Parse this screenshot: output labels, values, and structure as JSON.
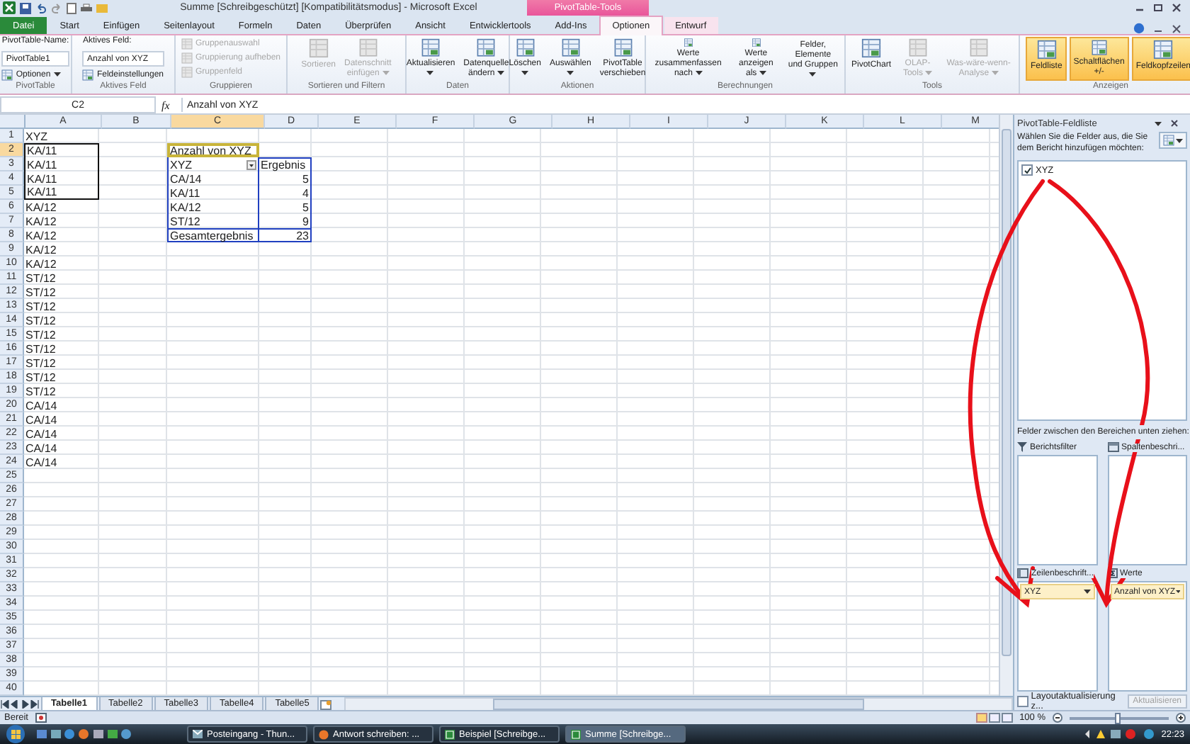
{
  "title_bar": {
    "title": "Summe [Schreibgeschützt] [Kompatibilitätsmodus] - Microsoft Excel",
    "contextual_tab": "PivotTable-Tools"
  },
  "ribbon_tabs": [
    {
      "label": "Datei",
      "kind": "file",
      "selected": false
    },
    {
      "label": "Start",
      "kind": "tab",
      "selected": false
    },
    {
      "label": "Einfügen",
      "kind": "tab",
      "selected": false
    },
    {
      "label": "Seitenlayout",
      "kind": "tab",
      "selected": false
    },
    {
      "label": "Formeln",
      "kind": "tab",
      "selected": false
    },
    {
      "label": "Daten",
      "kind": "tab",
      "selected": false
    },
    {
      "label": "Überprüfen",
      "kind": "tab",
      "selected": false
    },
    {
      "label": "Ansicht",
      "kind": "tab",
      "selected": false
    },
    {
      "label": "Entwicklertools",
      "kind": "tab",
      "selected": false
    },
    {
      "label": "Add-Ins",
      "kind": "tab",
      "selected": false
    },
    {
      "label": "Optionen",
      "kind": "context",
      "selected": true
    },
    {
      "label": "Entwurf",
      "kind": "context",
      "selected": false
    }
  ],
  "ribbon_groups": [
    {
      "label": "PivotTable",
      "items": [
        {
          "kind": "caption",
          "label": "PivotTable-Name:"
        },
        {
          "kind": "field",
          "label": "PivotTable1"
        },
        {
          "kind": "small",
          "label": "Optionen",
          "dropdown": true,
          "disabled": false
        }
      ]
    },
    {
      "label": "Aktives Feld",
      "items": [
        {
          "kind": "caption",
          "label": "Aktives Feld:"
        },
        {
          "kind": "field",
          "label": "Anzahl von XYZ"
        },
        {
          "kind": "small",
          "label": "Feldeinstellungen",
          "dropdown": false,
          "disabled": false
        }
      ]
    },
    {
      "label": "Gruppieren",
      "items": [
        {
          "kind": "small",
          "label": "Gruppenauswahl",
          "dropdown": false,
          "disabled": true
        },
        {
          "kind": "small",
          "label": "Gruppierung aufheben",
          "dropdown": false,
          "disabled": true
        },
        {
          "kind": "small",
          "label": "Gruppenfeld",
          "dropdown": false,
          "disabled": true
        }
      ]
    },
    {
      "label": "Sortieren und Filtern",
      "items": [
        {
          "kind": "large",
          "label": "Sortieren",
          "dropdown": false,
          "disabled": true
        },
        {
          "kind": "large",
          "label": "Datenschnitt\neinfügen",
          "dropdown": true,
          "disabled": true
        }
      ]
    },
    {
      "label": "Daten",
      "items": [
        {
          "kind": "large",
          "label": "Aktualisieren",
          "dropdown": true,
          "disabled": false
        },
        {
          "kind": "large",
          "label": "Datenquelle\nändern",
          "dropdown": true,
          "disabled": false
        }
      ]
    },
    {
      "label": "Aktionen",
      "items": [
        {
          "kind": "large",
          "label": "Löschen",
          "dropdown": true,
          "disabled": false
        },
        {
          "kind": "large",
          "label": "Auswählen",
          "dropdown": true,
          "disabled": false
        },
        {
          "kind": "large",
          "label": "PivotTable\nverschieben",
          "dropdown": false,
          "disabled": false
        }
      ]
    },
    {
      "label": "Berechnungen",
      "items": [
        {
          "kind": "large",
          "label": "Werte zusammenfassen\nnach",
          "dropdown": true,
          "disabled": false
        },
        {
          "kind": "large",
          "label": "Werte\nanzeigen als",
          "dropdown": true,
          "disabled": false
        },
        {
          "kind": "large",
          "label": "Felder, Elemente\nund Gruppen",
          "dropdown": true,
          "disabled": false
        }
      ]
    },
    {
      "label": "Tools",
      "items": [
        {
          "kind": "large",
          "label": "PivotChart",
          "dropdown": false,
          "disabled": false
        },
        {
          "kind": "large",
          "label": "OLAP-Tools",
          "dropdown": true,
          "disabled": true
        },
        {
          "kind": "large",
          "label": "Was-wäre-wenn-Analyse",
          "dropdown": true,
          "disabled": true
        }
      ]
    },
    {
      "label": "Anzeigen",
      "items": [
        {
          "kind": "toggle",
          "label": "Feldliste",
          "on": true
        },
        {
          "kind": "toggle",
          "label": "Schaltflächen\n+/-",
          "on": true
        },
        {
          "kind": "toggle",
          "label": "Feldkopfzeilen",
          "on": true
        }
      ]
    }
  ],
  "formula_bar": {
    "name_box": "C2",
    "function_label": "fx",
    "formula": "Anzahl von XYZ"
  },
  "columns": [
    {
      "label": "A",
      "selected": false
    },
    {
      "label": "B",
      "selected": false
    },
    {
      "label": "C",
      "selected": true
    },
    {
      "label": "D",
      "selected": false
    },
    {
      "label": "E",
      "selected": false
    },
    {
      "label": "F",
      "selected": false
    },
    {
      "label": "G",
      "selected": false
    },
    {
      "label": "H",
      "selected": false
    },
    {
      "label": "I",
      "selected": false
    },
    {
      "label": "J",
      "selected": false
    },
    {
      "label": "K",
      "selected": false
    },
    {
      "label": "L",
      "selected": false
    },
    {
      "label": "M",
      "selected": false
    }
  ],
  "rows": [
    {
      "number": "1",
      "selected": false,
      "cells": {
        "A": {
          "text": "XYZ",
          "kind": "text"
        }
      }
    },
    {
      "number": "2",
      "selected": true,
      "cells": {
        "A": {
          "text": "KA/11",
          "kind": "marked_top"
        },
        "C": {
          "text": "Anzahl von XYZ",
          "kind": "pivot_title"
        }
      }
    },
    {
      "number": "3",
      "selected": false,
      "cells": {
        "A": {
          "text": "KA/11",
          "kind": "marked"
        },
        "C": {
          "text": "XYZ",
          "kind": "pivot_filter"
        },
        "D": {
          "text": "Ergebnis",
          "kind": "pivot_head"
        }
      }
    },
    {
      "number": "4",
      "selected": false,
      "cells": {
        "A": {
          "text": "KA/11",
          "kind": "marked"
        },
        "C": {
          "text": "CA/14",
          "kind": "pivot_item"
        },
        "D": {
          "text": "5",
          "kind": "pivot_value"
        }
      }
    },
    {
      "number": "5",
      "selected": false,
      "cells": {
        "A": {
          "text": "KA/11",
          "kind": "marked_bottom"
        },
        "C": {
          "text": "KA/11",
          "kind": "pivot_item"
        },
        "D": {
          "text": "4",
          "kind": "pivot_value"
        }
      }
    },
    {
      "number": "6",
      "selected": false,
      "cells": {
        "A": {
          "text": "KA/12",
          "kind": "text"
        },
        "C": {
          "text": "KA/12",
          "kind": "pivot_item"
        },
        "D": {
          "text": "5",
          "kind": "pivot_value"
        }
      }
    },
    {
      "number": "7",
      "selected": false,
      "cells": {
        "A": {
          "text": "KA/12",
          "kind": "text"
        },
        "C": {
          "text": "ST/12",
          "kind": "pivot_item"
        },
        "D": {
          "text": "9",
          "kind": "pivot_value"
        }
      }
    },
    {
      "number": "8",
      "selected": false,
      "cells": {
        "A": {
          "text": "KA/12",
          "kind": "text"
        },
        "C": {
          "text": "Gesamtergebnis",
          "kind": "pivot_total_label"
        },
        "D": {
          "text": "23",
          "kind": "pivot_total_value"
        }
      }
    },
    {
      "number": "9",
      "selected": false,
      "cells": {
        "A": {
          "text": "KA/12",
          "kind": "text"
        }
      }
    },
    {
      "number": "10",
      "selected": false,
      "cells": {
        "A": {
          "text": "KA/12",
          "kind": "text"
        }
      }
    },
    {
      "number": "11",
      "selected": false,
      "cells": {
        "A": {
          "text": "ST/12",
          "kind": "text"
        }
      }
    },
    {
      "number": "12",
      "selected": false,
      "cells": {
        "A": {
          "text": "ST/12",
          "kind": "text"
        }
      }
    },
    {
      "number": "13",
      "selected": false,
      "cells": {
        "A": {
          "text": "ST/12",
          "kind": "text"
        }
      }
    },
    {
      "number": "14",
      "selected": false,
      "cells": {
        "A": {
          "text": "ST/12",
          "kind": "text"
        }
      }
    },
    {
      "number": "15",
      "selected": false,
      "cells": {
        "A": {
          "text": "ST/12",
          "kind": "text"
        }
      }
    },
    {
      "number": "16",
      "selected": false,
      "cells": {
        "A": {
          "text": "ST/12",
          "kind": "text"
        }
      }
    },
    {
      "number": "17",
      "selected": false,
      "cells": {
        "A": {
          "text": "ST/12",
          "kind": "text"
        }
      }
    },
    {
      "number": "18",
      "selected": false,
      "cells": {
        "A": {
          "text": "ST/12",
          "kind": "text"
        }
      }
    },
    {
      "number": "19",
      "selected": false,
      "cells": {
        "A": {
          "text": "ST/12",
          "kind": "text"
        }
      }
    },
    {
      "number": "20",
      "selected": false,
      "cells": {
        "A": {
          "text": "CA/14",
          "kind": "text"
        }
      }
    },
    {
      "number": "21",
      "selected": false,
      "cells": {
        "A": {
          "text": "CA/14",
          "kind": "text"
        }
      }
    },
    {
      "number": "22",
      "selected": false,
      "cells": {
        "A": {
          "text": "CA/14",
          "kind": "text"
        }
      }
    },
    {
      "number": "23",
      "selected": false,
      "cells": {
        "A": {
          "text": "CA/14",
          "kind": "text"
        }
      }
    },
    {
      "number": "24",
      "selected": false,
      "cells": {
        "A": {
          "text": "CA/14",
          "kind": "text"
        }
      }
    },
    {
      "number": "25",
      "selected": false
    },
    {
      "number": "26",
      "selected": false
    },
    {
      "number": "27",
      "selected": false
    },
    {
      "number": "28",
      "selected": false
    },
    {
      "number": "29",
      "selected": false
    },
    {
      "number": "30",
      "selected": false
    },
    {
      "number": "31",
      "selected": false
    },
    {
      "number": "32",
      "selected": false
    },
    {
      "number": "33",
      "selected": false
    },
    {
      "number": "34",
      "selected": false
    },
    {
      "number": "35",
      "selected": false
    },
    {
      "number": "36",
      "selected": false
    },
    {
      "number": "37",
      "selected": false
    },
    {
      "number": "38",
      "selected": false
    },
    {
      "number": "39",
      "selected": false
    },
    {
      "number": "40",
      "selected": false
    }
  ],
  "sheet_tabs": [
    {
      "label": "Tabelle1",
      "selected": true
    },
    {
      "label": "Tabelle2",
      "selected": false
    },
    {
      "label": "Tabelle3",
      "selected": false
    },
    {
      "label": "Tabelle4",
      "selected": false
    },
    {
      "label": "Tabelle5",
      "selected": false
    }
  ],
  "field_list": {
    "title": "PivotTable-Feldliste",
    "instruction": "Wählen Sie die Felder aus, die Sie dem Bericht hinzufügen möchten:",
    "fields": [
      {
        "label": "XYZ",
        "checked": true
      }
    ],
    "areas_instruction": "Felder zwischen den Bereichen unten ziehen:",
    "areas": [
      {
        "kind": "filter",
        "label": "Berichtsfilter"
      },
      {
        "kind": "columns",
        "label": "Spaltenbeschri..."
      },
      {
        "kind": "rows",
        "label": "Zeilenbeschrift...",
        "items": [
          "XYZ"
        ]
      },
      {
        "kind": "values",
        "label": "Werte",
        "items": [
          "Anzahl von XYZ"
        ]
      }
    ],
    "defer_update": {
      "label": "Layoutaktualisierung z...",
      "checked": false
    },
    "update_button": {
      "label": "Aktualisieren",
      "disabled": true
    }
  },
  "status_bar": {
    "text": "Bereit",
    "zoom": "100 %",
    "zoom_slider": {
      "level": 0.5
    }
  },
  "taskbar": {
    "items": [
      {
        "label": "Posteingang - Thun...",
        "kind": "mail",
        "selected": false
      },
      {
        "label": "Antwort schreiben: ...",
        "kind": "browser",
        "selected": false
      },
      {
        "label": "Beispiel [Schreibge...",
        "kind": "sheet",
        "selected": false
      },
      {
        "label": "Summe [Schreibge...",
        "kind": "sheet",
        "selected": true
      }
    ],
    "clock": "22:23"
  }
}
